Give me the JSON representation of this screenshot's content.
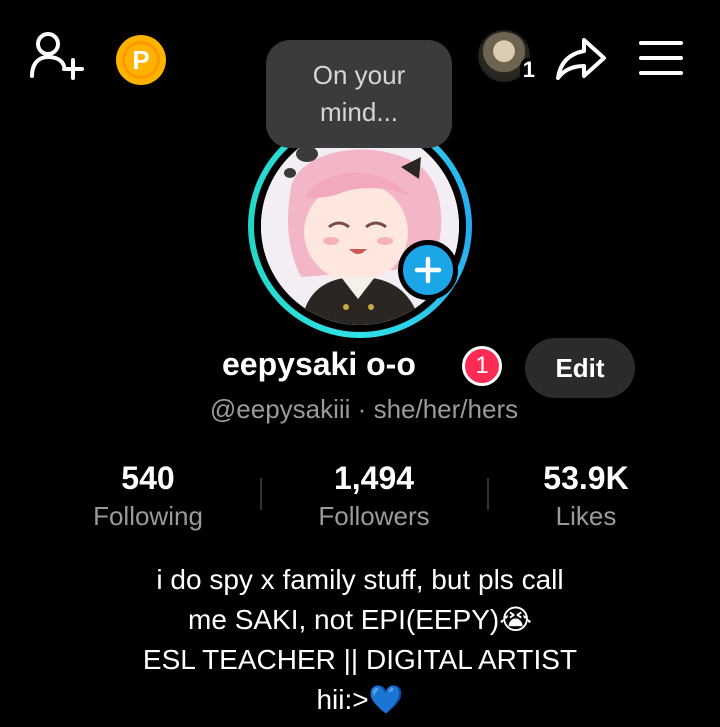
{
  "header": {
    "coin_letter": "P",
    "visitors_count": "1"
  },
  "bubble": {
    "line1": "On your",
    "line2": "mind..."
  },
  "profile": {
    "display_name": "eepysaki o-o",
    "notification_count": "1",
    "edit_label": "Edit",
    "handle": "@eepysakiii",
    "separator": "·",
    "pronouns": "she/her/hers"
  },
  "stats": [
    {
      "value": "540",
      "label": "Following"
    },
    {
      "value": "1,494",
      "label": "Followers"
    },
    {
      "value": "53.9K",
      "label": "Likes"
    }
  ],
  "bio": {
    "line1": "i do spy x family stuff, but pls call",
    "line2": "me SAKI, not EPI(EEPY)😭",
    "line3": "ESL TEACHER || DIGITAL ARTIST",
    "line4": "hii:>💙"
  },
  "colors": {
    "background": "#000000",
    "accent_ring": "#2fe1e6",
    "add_story": "#1ba6e8",
    "badge": "#fe2c55",
    "coin": "#ffb300"
  },
  "icons": [
    "add-friend-icon",
    "coin-icon",
    "share-icon",
    "menu-icon",
    "plus-icon"
  ]
}
